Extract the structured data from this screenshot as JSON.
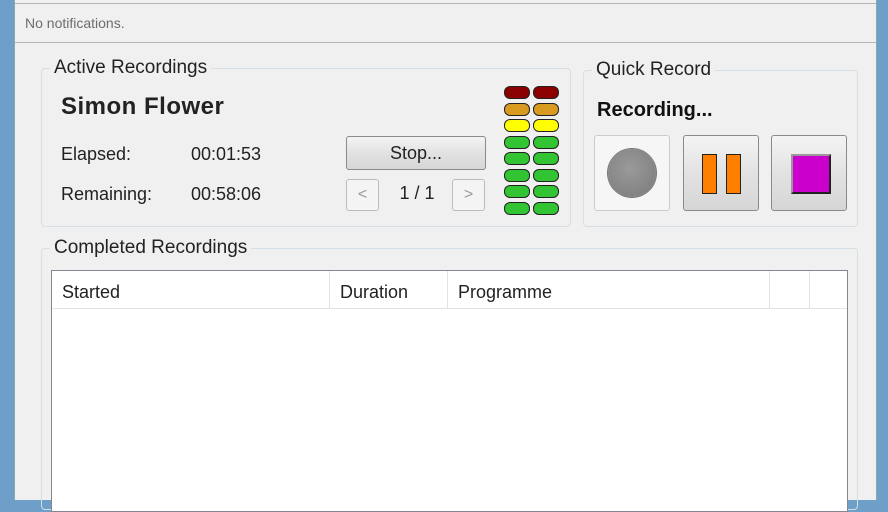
{
  "notification": "No notifications.",
  "active": {
    "title": "Active Recordings",
    "programme": "Simon Flower",
    "elapsed_label": "Elapsed:",
    "elapsed": "00:01:53",
    "remaining_label": "Remaining:",
    "remaining": "00:58:06",
    "stop_label": "Stop...",
    "page": "1 / 1",
    "prev": "<",
    "next": ">"
  },
  "meter": {
    "levels": [
      "#8b0000",
      "#d89a20",
      "#ffff00",
      "#33c433",
      "#33c433",
      "#33c433",
      "#33c433",
      "#33c433"
    ]
  },
  "quick": {
    "title": "Quick Record",
    "status": "Recording...",
    "colors": {
      "record": "#8a8a8a",
      "pause": "#ff8000",
      "stop": "#cc00cc"
    }
  },
  "completed": {
    "title": "Completed Recordings",
    "columns": [
      "Started",
      "Duration",
      "Programme",
      "",
      ""
    ]
  }
}
